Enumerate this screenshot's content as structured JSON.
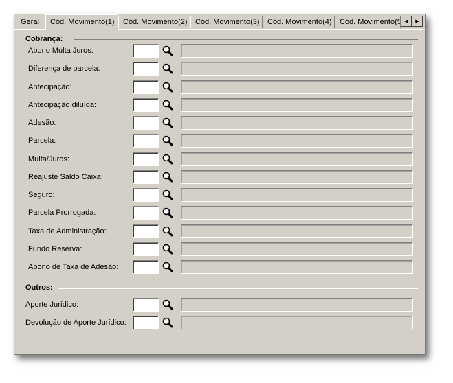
{
  "tabs": [
    {
      "label": "Geral",
      "active": false
    },
    {
      "label": "Cód. Movimento(1)",
      "active": true
    },
    {
      "label": "Cód. Movimento(2)",
      "active": false
    },
    {
      "label": "Cód. Movimento(3)",
      "active": false
    },
    {
      "label": "Cód. Movimento(4)",
      "active": false
    },
    {
      "label": "Cód. Movimento(5",
      "active": false
    }
  ],
  "scroll": {
    "left": "◀",
    "right": "▶"
  },
  "cobranca": {
    "title": "Cobrança:",
    "rows": [
      {
        "label": "Abono Multa Juros:",
        "code": "",
        "description": ""
      },
      {
        "label": "Diferença de parcela:",
        "code": "",
        "description": ""
      },
      {
        "label": "Antecipação:",
        "code": "",
        "description": ""
      },
      {
        "label": "Antecipação diluída:",
        "code": "",
        "description": ""
      },
      {
        "label": "Adesão:",
        "code": "",
        "description": ""
      },
      {
        "label": "Parcela:",
        "code": "",
        "description": ""
      },
      {
        "label": "Multa/Juros:",
        "code": "",
        "description": ""
      },
      {
        "label": "Reajuste Saldo Caixa:",
        "code": "",
        "description": ""
      },
      {
        "label": "Seguro:",
        "code": "",
        "description": ""
      },
      {
        "label": "Parcela Prorrogada:",
        "code": "",
        "description": ""
      },
      {
        "label": "Taxa de Administração:",
        "code": "",
        "description": ""
      },
      {
        "label": "Fundo Reserva:",
        "code": "",
        "description": ""
      },
      {
        "label": "Abono de Taxa de Adesão:",
        "code": "",
        "description": ""
      }
    ]
  },
  "outros": {
    "title": "Outros:",
    "rows": [
      {
        "label": "Aporte Jurídico:",
        "code": "",
        "description": ""
      },
      {
        "label": "Devolução de Aporte Jurídico:",
        "code": "",
        "description": ""
      }
    ]
  }
}
